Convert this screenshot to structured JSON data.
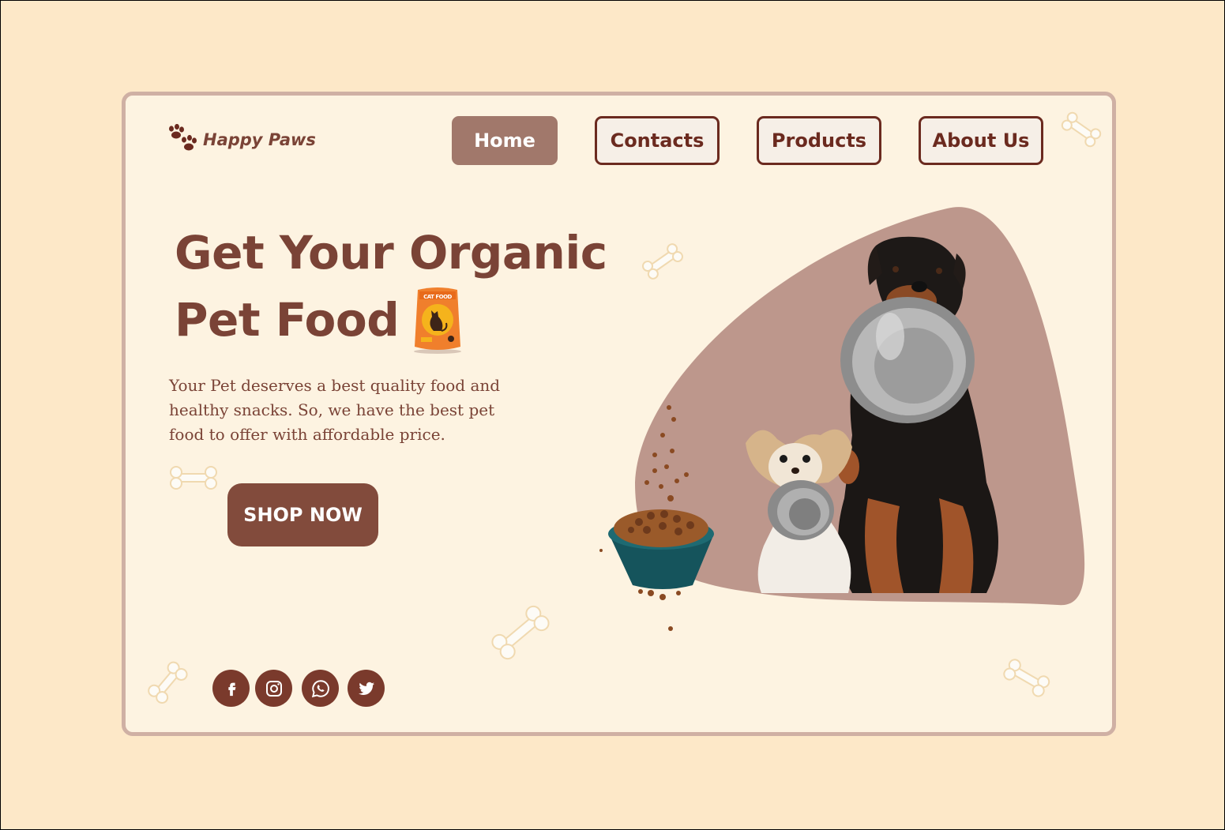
{
  "brand": {
    "name": "Happy Paws",
    "icon": "paw-icon"
  },
  "nav": {
    "items": [
      {
        "label": "Home",
        "active": true
      },
      {
        "label": "Contacts",
        "active": false
      },
      {
        "label": "Products",
        "active": false
      },
      {
        "label": "About Us",
        "active": false
      }
    ]
  },
  "hero": {
    "headline_line1": "Get Your Organic",
    "headline_line2": "Pet Food",
    "description": "Your Pet deserves a best quality food and healthy  snacks. So, we have the best pet food to offer with affordable price.",
    "cta_label": "SHOP NOW",
    "food_bag_label": "CAT FOOD"
  },
  "social": {
    "icons": [
      "facebook-icon",
      "instagram-icon",
      "whatsapp-icon",
      "twitter-icon"
    ]
  },
  "colors": {
    "page_bg": "#fde8c8",
    "card_bg": "#fdf3e1",
    "accent": "#7a4336",
    "active_nav": "#a1786b",
    "blob": "#bd978c"
  }
}
